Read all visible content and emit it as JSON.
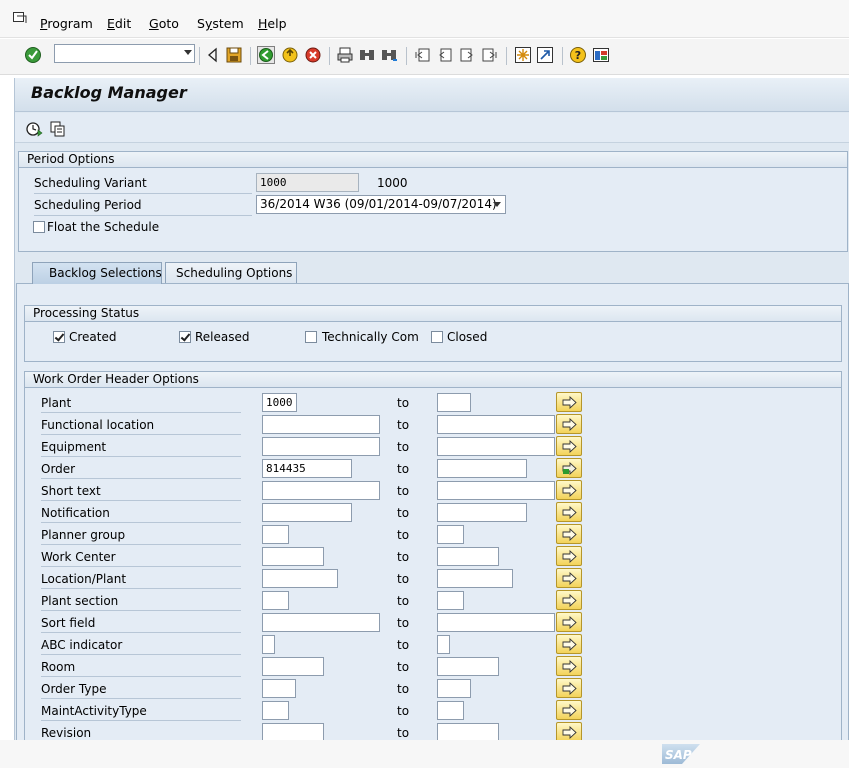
{
  "menubar": {
    "items": [
      {
        "label": "Program",
        "accel": "P"
      },
      {
        "label": "Edit",
        "accel": "E"
      },
      {
        "label": "Goto",
        "accel": "G"
      },
      {
        "label": "System",
        "accel": "y"
      },
      {
        "label": "Help",
        "accel": "H"
      }
    ]
  },
  "toolbar": {
    "command_field_value": "",
    "icons": [
      "enter-icon",
      "back-arrow-icon",
      "save-icon",
      "back-icon",
      "exit-icon",
      "cancel-icon",
      "print-icon",
      "find-icon",
      "find-next-icon",
      "first-page-icon",
      "previous-page-icon",
      "next-page-icon",
      "last-page-icon",
      "create-session-icon",
      "shortcut-icon",
      "help-icon",
      "layout-icon"
    ]
  },
  "title": "Backlog Manager",
  "app_toolbar": {
    "icons": [
      "execute-icon",
      "get-variant-icon"
    ]
  },
  "period_options": {
    "title": "Period Options",
    "scheduling_variant": {
      "label": "Scheduling Variant",
      "value": "1000",
      "text": "1000"
    },
    "scheduling_period": {
      "label": "Scheduling Period",
      "value": "36/2014 W36 (09/01/2014-09/07/2014)"
    },
    "float_schedule": {
      "label": "Float the Schedule",
      "checked": false
    }
  },
  "tabs": [
    {
      "label": "Backlog Selections",
      "active": true
    },
    {
      "label": "Scheduling Options",
      "active": false
    }
  ],
  "processing_status": {
    "title": "Processing Status",
    "items": [
      {
        "label": "Created",
        "checked": true
      },
      {
        "label": "Released",
        "checked": true
      },
      {
        "label": "Technically Com",
        "checked": false
      },
      {
        "label": "Closed",
        "checked": false
      }
    ]
  },
  "work_order": {
    "title": "Work Order Header Options",
    "to_label": "to",
    "rows": [
      {
        "label": "Plant",
        "from": "1000",
        "to": ""
      },
      {
        "label": "Functional location",
        "from": "",
        "to": ""
      },
      {
        "label": "Equipment",
        "from": "",
        "to": ""
      },
      {
        "label": "Order",
        "from": "814435",
        "to": ""
      },
      {
        "label": "Short text",
        "from": "",
        "to": ""
      },
      {
        "label": "Notification",
        "from": "",
        "to": ""
      },
      {
        "label": "Planner group",
        "from": "",
        "to": ""
      },
      {
        "label": "Work Center",
        "from": "",
        "to": ""
      },
      {
        "label": "Location/Plant",
        "from": "",
        "to": ""
      },
      {
        "label": "Plant section",
        "from": "",
        "to": ""
      },
      {
        "label": "Sort field",
        "from": "",
        "to": ""
      },
      {
        "label": "ABC indicator",
        "from": "",
        "to": ""
      },
      {
        "label": "Room",
        "from": "",
        "to": ""
      },
      {
        "label": "Order Type",
        "from": "",
        "to": ""
      },
      {
        "label": "MaintActivityType",
        "from": "",
        "to": ""
      },
      {
        "label": "Revision",
        "from": "",
        "to": ""
      }
    ]
  },
  "footer": {
    "logo_text": "SAP"
  }
}
